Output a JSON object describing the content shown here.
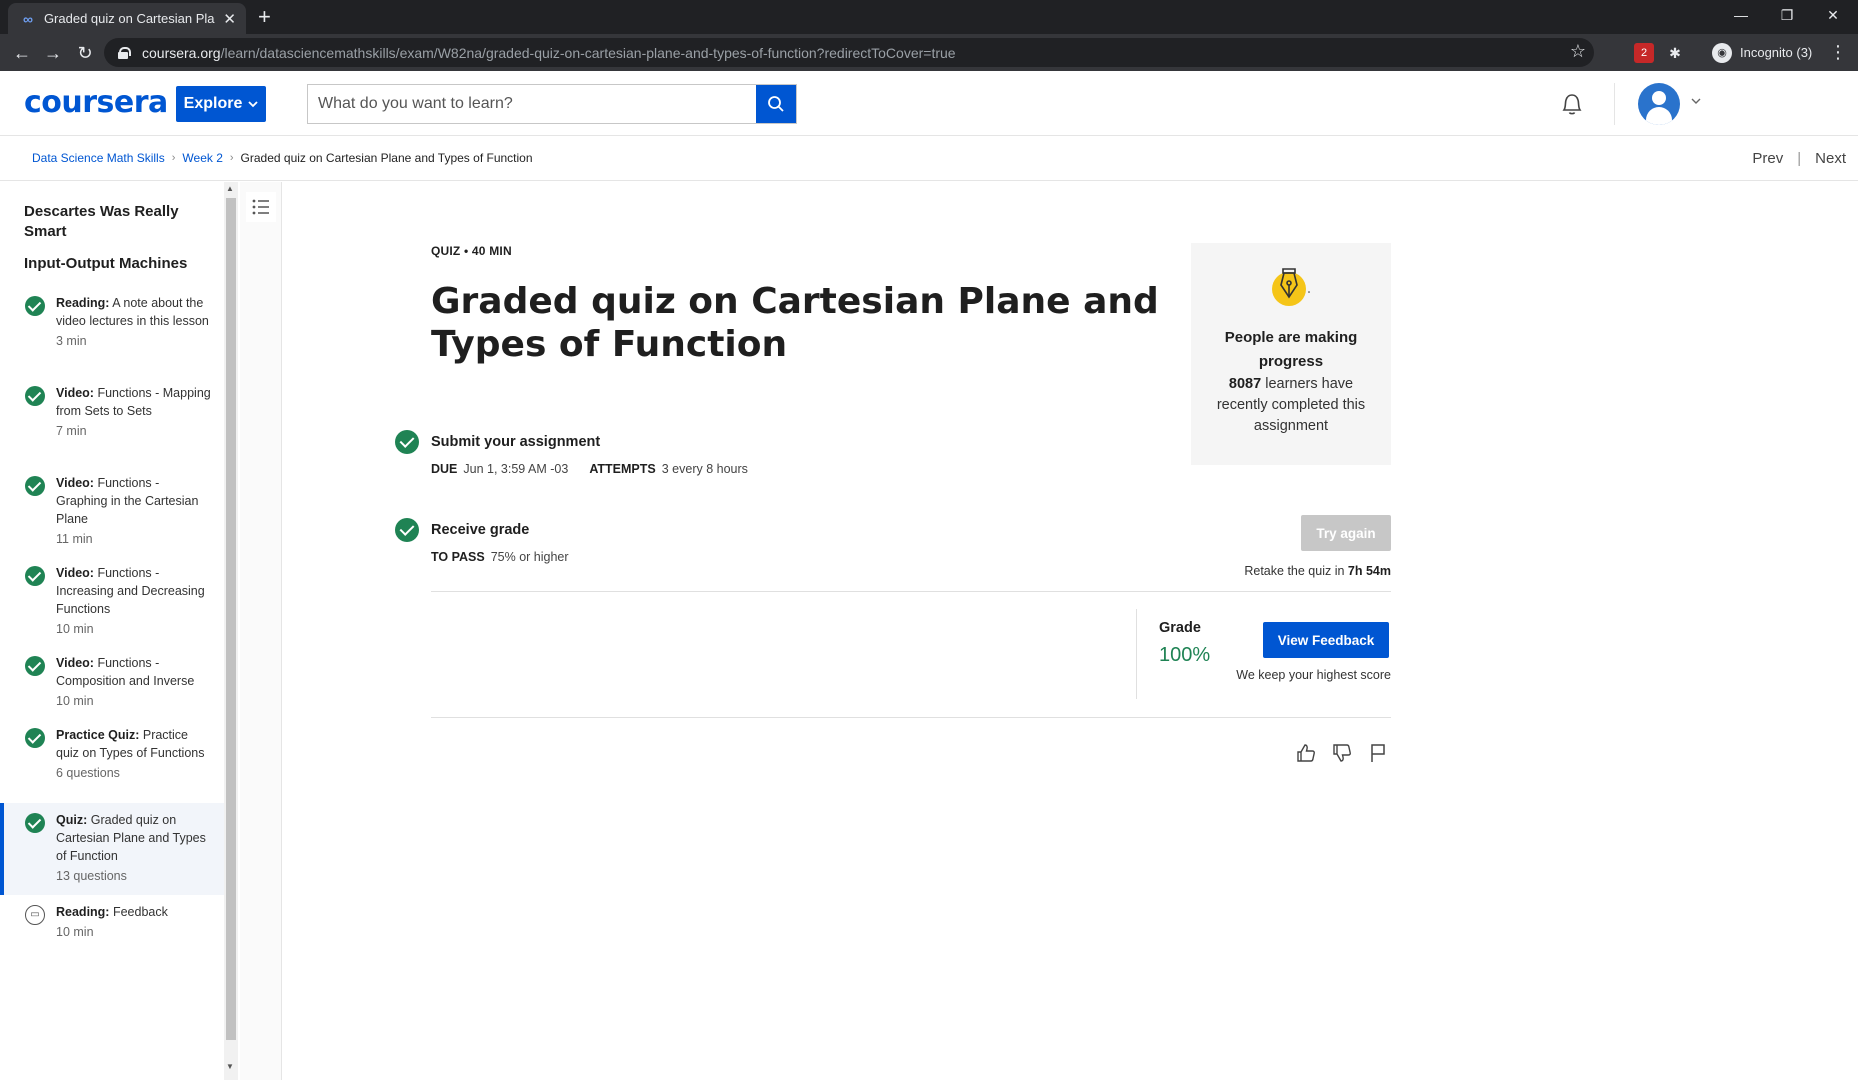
{
  "browser": {
    "tab_title": "Graded quiz on Cartesian Plane a",
    "url_host": "coursera.org",
    "url_path": "/learn/datasciencemathskills/exam/W82na/graded-quiz-on-cartesian-plane-and-types-of-function?redirectToCover=true",
    "incognito_label": "Incognito (3)",
    "extension_badge": "2"
  },
  "header": {
    "logo": "coursera",
    "explore_label": "Explore",
    "search_placeholder": "What do you want to learn?"
  },
  "breadcrumb": {
    "items": [
      "Data Science Math Skills",
      "Week 2"
    ],
    "current": "Graded quiz on Cartesian Plane and Types of Function",
    "prev": "Prev",
    "next": "Next"
  },
  "sidebar": {
    "headings": [
      "Descartes Was Really Smart",
      "Input-Output Machines"
    ],
    "items": [
      {
        "type": "Reading:",
        "title": "A note about the video lectures in this lesson",
        "meta": "3 min"
      },
      {
        "type": "Video:",
        "title": "Functions - Mapping from Sets to Sets",
        "meta": "7 min"
      },
      {
        "type": "Video:",
        "title": "Functions - Graphing in the Cartesian Plane",
        "meta": "11 min"
      },
      {
        "type": "Video:",
        "title": "Functions - Increasing and Decreasing Functions",
        "meta": "10 min"
      },
      {
        "type": "Video:",
        "title": "Functions - Composition and Inverse",
        "meta": "10 min"
      },
      {
        "type": "Practice Quiz:",
        "title": "Practice quiz on Types of Functions",
        "meta": "6 questions"
      },
      {
        "type": "Quiz:",
        "title": "Graded quiz on Cartesian Plane and Types of Function",
        "meta": "13 questions"
      },
      {
        "type": "Reading:",
        "title": "Feedback",
        "meta": "10 min"
      }
    ]
  },
  "main": {
    "label": "QUIZ • 40 MIN",
    "title": "Graded quiz on Cartesian Plane and Types of Function",
    "progress_card": {
      "title": "People are making progress",
      "count": "8087",
      "text": "learners have recently completed this assignment"
    },
    "submit": {
      "title": "Submit your assignment",
      "due_label": "DUE",
      "due_value": "Jun 1, 3:59 AM -03",
      "attempts_label": "ATTEMPTS",
      "attempts_value": "3 every 8 hours",
      "try_again": "Try again",
      "retake_prefix": "Retake the quiz in",
      "retake_time": "7h 54m"
    },
    "grade": {
      "title": "Receive grade",
      "pass_label": "TO PASS",
      "pass_value": "75% or higher",
      "grade_label": "Grade",
      "grade_value": "100%",
      "view_feedback": "View Feedback",
      "keep_note": "We keep your highest score"
    }
  }
}
